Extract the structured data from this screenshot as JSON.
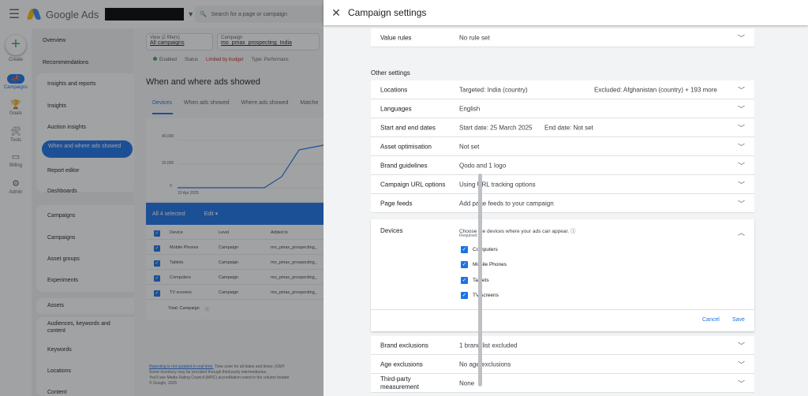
{
  "app": {
    "name": "Google Ads",
    "search_placeholder": "Search for a page or campaign"
  },
  "rail": [
    {
      "label": "Create",
      "icon": "plus-icon"
    },
    {
      "label": "Campaigns",
      "icon": "megaphone-icon"
    },
    {
      "label": "Goals",
      "icon": "trophy-icon"
    },
    {
      "label": "Tools",
      "icon": "tools-icon"
    },
    {
      "label": "Billing",
      "icon": "credit-card-icon"
    },
    {
      "label": "Admin",
      "icon": "gear-icon"
    }
  ],
  "sidebar": {
    "overview": "Overview",
    "recommendations": "Recommendations",
    "insights_reports": "Insights and reports",
    "insights": "Insights",
    "auction_insights": "Auction insights",
    "when_where": "When and where ads showed",
    "report_editor": "Report editor",
    "dashboards": "Dashboards",
    "campaigns_group": "Campaigns",
    "campaigns": "Campaigns",
    "asset_groups": "Asset groups",
    "experiments": "Experiments",
    "assets": "Assets",
    "audiences": "Audiences, keywords and content",
    "keywords": "Keywords",
    "locations": "Locations",
    "content": "Content"
  },
  "main": {
    "view_label": "View (2 filters)",
    "view_value": "All campaigns",
    "campaign_label": "Campaign",
    "campaign_value": "mo_pmax_prospecting_India",
    "status_enabled": "Enabled",
    "status_label": "Status",
    "status_limited": "Limited by budget",
    "type_label": "Type: Performanc",
    "title": "When and where ads showed",
    "tabs": [
      "Devices",
      "When ads showed",
      "Where ads showed",
      "Matche"
    ],
    "chart_y": [
      "40,000",
      "20,000",
      "0"
    ],
    "chart_x": "10 Apr 2025",
    "selected": "All 4 selected",
    "edit": "Edit",
    "columns": [
      "Device",
      "Level",
      "Added to"
    ],
    "rows": [
      {
        "device": "Mobile Phones",
        "level": "Campaign",
        "added": "mo_pmax_prospecting_"
      },
      {
        "device": "Tablets",
        "level": "Campaign",
        "added": "mo_pmax_prospecting_"
      },
      {
        "device": "Computers",
        "level": "Campaign",
        "added": "mo_pmax_prospecting_"
      },
      {
        "device": "TV screens",
        "level": "Campaign",
        "added": "mo_pmax_prospecting_"
      }
    ],
    "total": "Total: Campaign",
    "foot_link": "Reporting is not updated in real time.",
    "foot_1": " Time zone for all dates and times: (GMT",
    "foot_2": "Some inventory may be provided through third-party intermediaries.",
    "foot_3": "You'll see Media Rating Council (MRC) accreditation noted in the column header",
    "foot_4": "© Google, 2025"
  },
  "panel": {
    "title": "Campaign settings",
    "value_rules": {
      "label": "Value rules",
      "value": "No rule set"
    },
    "other_settings": "Other settings",
    "locations": {
      "label": "Locations",
      "value": "Targeted: India (country)",
      "value2": "Excluded: Afghanistan (country) + 193 more"
    },
    "languages": {
      "label": "Languages",
      "value": "English"
    },
    "dates": {
      "label": "Start and end dates",
      "value": "Start date: 25 March 2025",
      "value2": "End date: Not set"
    },
    "asset_opt": {
      "label": "Asset optimisation",
      "value": "Not set"
    },
    "brand_guidelines": {
      "label": "Brand guidelines",
      "value": "Qodo and 1 logo"
    },
    "url_options": {
      "label": "Campaign URL options",
      "value": "Using URL tracking options"
    },
    "page_feeds": {
      "label": "Page feeds",
      "value": "Add page feeds to your campaign"
    },
    "devices": {
      "label": "Devices",
      "desc": "Choose the devices where your ads can appear.",
      "required": "Required",
      "options": [
        "Computers",
        "Mobile Phones",
        "Tablets",
        "TV screens"
      ],
      "cancel": "Cancel",
      "save": "Save"
    },
    "brand_exclusions": {
      "label": "Brand exclusions",
      "value": "1 brand list excluded"
    },
    "age_exclusions": {
      "label": "Age exclusions",
      "value": "No age exclusions"
    },
    "third_party": {
      "label": "Third-party measurement",
      "value": "None"
    }
  }
}
